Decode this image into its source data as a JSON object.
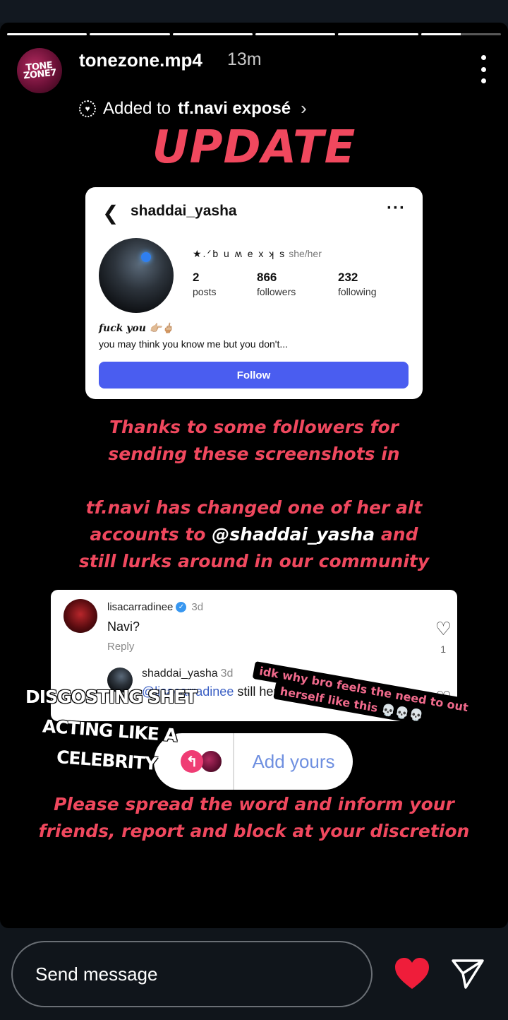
{
  "story": {
    "progress": [
      1,
      1,
      1,
      1,
      1,
      0.5
    ],
    "username": "tonezone.mp4",
    "avatar_text": "TONE ZONE7",
    "time_ago": "13m",
    "added_prefix": "Added to",
    "added_highlight": "tf.navi exposé",
    "more_icon": "more-vertical-icon"
  },
  "content": {
    "headline": "UPDATE",
    "profile": {
      "username": "shaddai_yasha",
      "display_name": "★.ᐟb u ʍ e x ʞ s",
      "pronouns": "she/her",
      "posts_count": "2",
      "posts_label": "posts",
      "followers_count": "866",
      "followers_label": "followers",
      "following_count": "232",
      "following_label": "following",
      "bio_line1": "fuck you 👉🏼🖕🏼",
      "bio_line2": "you may think you know me but you don't...",
      "follow_label": "Follow"
    },
    "thanks_line1": "Thanks to some followers for",
    "thanks_line2": "sending these screenshots in",
    "changed_line1": "tf.navi has changed one of her alt",
    "changed_line2_a": "accounts to",
    "changed_line2_handle": "@shaddai_yasha",
    "changed_line2_b": "and",
    "changed_line3": "still lurks around in our community",
    "comments": {
      "user1": "lisacarradinee",
      "user1_ago": "3d",
      "text1": "Navi?",
      "reply_label": "Reply",
      "like_count": "1",
      "user2": "shaddai_yasha",
      "user2_ago": "3d",
      "text2_mention": "@lisacarradinee",
      "text2_rest": "still here"
    },
    "sticker_line1": "idk why bro feels the need to out",
    "sticker_line2": "herself like this 💀💀💀",
    "overlay_line1": "DISGOSTING SHET",
    "overlay_line2": "ACTING LIKE A",
    "overlay_line3": "CELEBRITY",
    "add_yours_label": "Add yours",
    "spread_line1": "Please spread the word and inform your",
    "spread_line2": "friends, report and block at your discretion"
  },
  "footer": {
    "message_placeholder": "Send message",
    "like_icon": "heart-icon",
    "send_icon": "send-icon"
  },
  "colors": {
    "accent_red": "#f0485e",
    "follow_blue": "#4a5df0",
    "add_yours_blue": "#6e8fe0",
    "heart_red": "#ef1d3a"
  }
}
